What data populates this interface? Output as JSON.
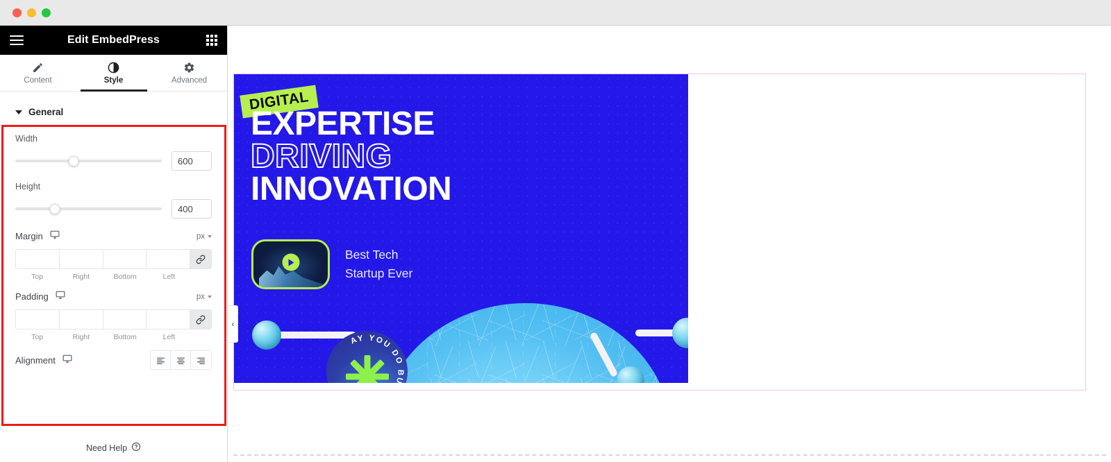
{
  "window": {
    "traffic_lights": [
      "close",
      "minimize",
      "zoom"
    ]
  },
  "panel": {
    "menu_icon": "hamburger-icon",
    "title": "Edit EmbedPress",
    "apps_icon": "apps-grid-icon",
    "tabs": [
      {
        "label": "Content",
        "icon": "pencil-icon",
        "active": false
      },
      {
        "label": "Style",
        "icon": "contrast-half-circle-icon",
        "active": true
      },
      {
        "label": "Advanced",
        "icon": "gear-icon",
        "active": false
      }
    ],
    "section": {
      "title": "General",
      "collapse_icon": "caret-down-icon"
    },
    "width": {
      "label": "Width",
      "value": "600",
      "slider_percent": 40
    },
    "height": {
      "label": "Height",
      "value": "400",
      "slider_percent": 27
    },
    "margin": {
      "label": "Margin",
      "device_icon": "desktop-monitor-icon",
      "unit": "px",
      "unit_chevron": "chevron-down-icon",
      "link_icon": "link-chain-icon",
      "values": [
        "",
        "",
        "",
        ""
      ],
      "sides": [
        "Top",
        "Right",
        "Bottom",
        "Left"
      ]
    },
    "padding": {
      "label": "Padding",
      "device_icon": "desktop-monitor-icon",
      "unit": "px",
      "unit_chevron": "chevron-down-icon",
      "link_icon": "link-chain-icon",
      "values": [
        "",
        "",
        "",
        ""
      ],
      "sides": [
        "Top",
        "Right",
        "Bottom",
        "Left"
      ]
    },
    "alignment": {
      "label": "Alignment",
      "device_icon": "desktop-monitor-icon",
      "options": [
        "align-left-icon",
        "align-center-icon",
        "align-right-icon"
      ]
    },
    "footer": {
      "label": "Need Help",
      "icon": "question-circle-icon"
    }
  },
  "canvas": {
    "collapse_handle": "chevron-left-icon",
    "embed": {
      "badge": "DIGITAL",
      "headline_line1": "EXPERTISE",
      "headline_line2": "DRIVING",
      "headline_line3": "INNOVATION",
      "video_title_line1": "Best Tech",
      "video_title_line2": "Startup Ever",
      "play_icon": "play-triangle-icon",
      "seal_text": "AY YOU DO BUSINESS TRA",
      "seal_star_icon": "asterisk-burst-icon"
    }
  },
  "colors": {
    "embed_background": "#2318e8",
    "accent_green": "#b6ef4f",
    "highlight_red": "#ee1b1b",
    "container_border_pink": "#f2c4ef",
    "panel_header_black": "#000000",
    "sphere_cyan": "#57c9f3"
  }
}
